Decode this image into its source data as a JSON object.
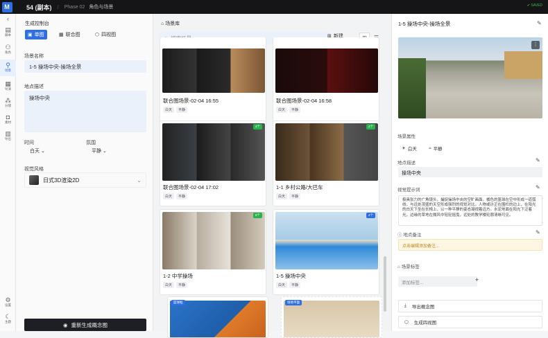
{
  "app": {
    "logo": "M",
    "title": "54 (副本)",
    "phase": "Phase 02",
    "subtitle": "角色与场景",
    "saved": "✔ SAVED"
  },
  "rail": [
    {
      "label": "脚本",
      "icon": "doc-icon"
    },
    {
      "label": "角色",
      "icon": "people-icon"
    },
    {
      "label": "场景",
      "icon": "location-icon"
    },
    {
      "label": "导演",
      "icon": "clapper-icon"
    },
    {
      "label": "分镜",
      "icon": "network-icon"
    },
    {
      "label": "素材",
      "icon": "camera-icon"
    },
    {
      "label": "导出",
      "icon": "film-icon"
    },
    {
      "label": "设置",
      "icon": "gear-icon"
    },
    {
      "label": "主题",
      "icon": "moon-icon"
    }
  ],
  "left": {
    "panel_title": "生成控制台",
    "modes": [
      "单图",
      "联合图",
      "四视图"
    ],
    "scene_name_label": "场景名称",
    "scene_name": "1-5 操场中央-操场全景",
    "location_label": "地点描述",
    "location": "操场中央",
    "time_label": "时间",
    "time_value": "白天",
    "mood_label": "氛围",
    "mood_value": "平静",
    "style_label": "视觉风格",
    "style_value": "日式3D渲染2D",
    "regen_label": "重新生成概念图"
  },
  "library": {
    "title": "场景库",
    "search_placeholder": "搜索场景...",
    "new_label": "新建",
    "cards": [
      {
        "name": "联合图场景-02-04 16:55",
        "tags": [
          "白天",
          "平静"
        ],
        "badge": ""
      },
      {
        "name": "联合图场景-02-04 16:58",
        "tags": [
          "白天",
          "平静"
        ],
        "badge": ""
      },
      {
        "name": "联合图场景-02-04 17:02",
        "tags": [
          "白天",
          "平静"
        ],
        "badge": "4个"
      },
      {
        "name": "1-1 乡村公路/大巴车",
        "tags": [
          "白天",
          "平静"
        ],
        "badge": "4个"
      },
      {
        "name": "1-2 中学操场",
        "tags": [
          "白天",
          "平静"
        ],
        "badge": "8个"
      },
      {
        "name": "1-5 操场中央",
        "tags": [
          "白天",
          "平静"
        ],
        "badge": "4个"
      },
      {
        "name": "",
        "tags": [],
        "badge": "篮球框"
      },
      {
        "name": "",
        "tags": [],
        "badge": "场地平面"
      }
    ]
  },
  "detail": {
    "title": "1-5 操场中央-操场全景",
    "attrs_label": "场景属性",
    "time": "白天",
    "mood": "平静",
    "location_label": "地点描述",
    "location": "操场中央",
    "prompt_label": "视觉提示词",
    "prompt": "极具张力的广角镜头，捕捉操场中央的空旷画面。橘色的篮球在空中形成一道弧线，与远处茂盛的天空形成强烈的视觉对比。人物或许正在围栏的边上，在阳光的白天下坐在长椅上，以一种平静的姿态凝视着远方。水泥地面在阳光下泛着光，边缘的草地在微风中轻轻摇曳，远处的教学楼轮廓清晰可见。",
    "note_label": "地点备注",
    "note_placeholder": "点击编辑添加备注...",
    "tags_label": "场景标签",
    "tag_placeholder": "添加标签...",
    "export_label": "导出概念图",
    "generate_label": "生成四视图"
  }
}
